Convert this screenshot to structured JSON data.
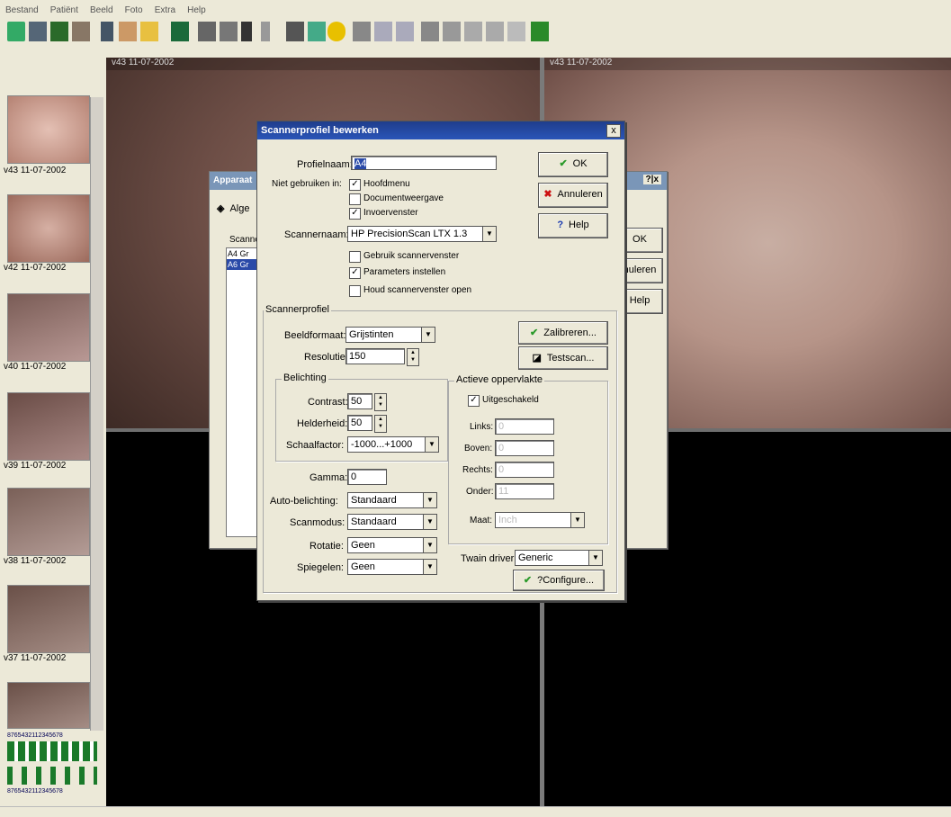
{
  "menubar": {
    "items": [
      "Bestand",
      "Patiënt",
      "Beeld",
      "Foto",
      "Extra",
      "Help"
    ]
  },
  "panes": {
    "left_caption": "v43 11-07-2002",
    "right_caption": "v43 11-07-2002"
  },
  "thumbs": [
    {
      "caption": "v43   11-07-2002"
    },
    {
      "caption": "v42   11-07-2002"
    },
    {
      "caption": "v40   11-07-2002"
    },
    {
      "caption": "v39   11-07-2002"
    },
    {
      "caption": "v38   11-07-2002"
    },
    {
      "caption": "v37   11-07-2002"
    }
  ],
  "tooth_chart": {
    "row1": "8765432112345678",
    "row2": "8765432112345678"
  },
  "bg_dialog": {
    "title": "Apparaat",
    "tab": "Alge",
    "list_label": "Scanne",
    "list_items": [
      "A4 Gr",
      "A6 Gr"
    ],
    "ok": "OK",
    "cancel": "nuleren",
    "help": "Help",
    "title_buttons": "?|x"
  },
  "dialog": {
    "title": "Scannerprofiel bewerken",
    "close": "x",
    "profile_label": "Profielnaam:",
    "profile_value": "A4",
    "notused_label": "Niet gebruiken in:",
    "chk_hoofdmenu": "Hoofdmenu",
    "chk_documentweergave": "Documentweergave",
    "chk_invoervenster": "Invoervenster",
    "scanner_label": "Scannernaam:",
    "scanner_value": "HP PrecisionScan LTX 1.3",
    "chk_gebruik": "Gebruik scannervenster",
    "chk_parameters": "Parameters instellen",
    "chk_houd": "Houd scannervenster open",
    "ok": "OK",
    "cancel": "Annuleren",
    "help": "Help",
    "group_scannerprofiel": "Scannerprofiel",
    "beeldformaat_label": "Beeldformaat:",
    "beeldformaat_value": "Grijstinten",
    "resolutie_label": "Resolutie:",
    "resolutie_value": "150",
    "kalibreren": "Zalibreren...",
    "testscan": "Testscan...",
    "group_belichting": "Belichting",
    "contrast_label": "Contrast:",
    "contrast_value": "50",
    "helderheid_label": "Helderheid:",
    "helderheid_value": "50",
    "schaalfactor_label": "Schaalfactor:",
    "schaalfactor_value": "-1000...+1000",
    "group_actieve": "Actieve oppervlakte",
    "chk_uitgeschakeld": "Uitgeschakeld",
    "links_label": "Links:",
    "links_value": "0",
    "boven_label": "Boven:",
    "boven_value": "0",
    "rechts_label": "Rechts:",
    "rechts_value": "0",
    "onder_label": "Onder:",
    "onder_value": "11",
    "maat_label": "Maat:",
    "maat_value": "Inch",
    "gamma_label": "Gamma:",
    "gamma_value": "0",
    "autobelichting_label": "Auto-belichting:",
    "autobelichting_value": "Standaard",
    "scanmodus_label": "Scanmodus:",
    "scanmodus_value": "Standaard",
    "rotatie_label": "Rotatie:",
    "rotatie_value": "Geen",
    "spiegelen_label": "Spiegelen:",
    "spiegelen_value": "Geen",
    "twain_label": "Twain driver:",
    "twain_value": "Generic",
    "configure": "?Configure..."
  },
  "colors": {
    "titlebar": "#1f3d8c",
    "accent_check": "#2a9a2a",
    "cancel_x": "#cc1111"
  }
}
